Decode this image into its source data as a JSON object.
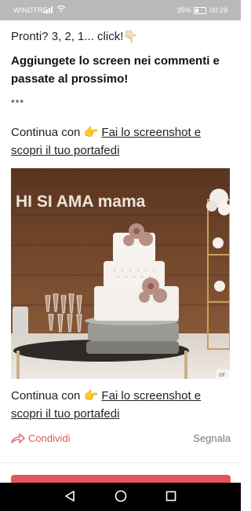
{
  "status_bar": {
    "carrier": "WINDTRE",
    "battery": "35%",
    "time": "00:29"
  },
  "post": {
    "line1": "Pronti? 3, 2, 1... click!👇🏻",
    "line2": "Aggiungete lo screen nei commenti e passate al prossimo!",
    "separator": "***",
    "continue_prefix": "Continua con 👉",
    "continue_link": "Fai lo screenshot e scopri il tuo portafedi",
    "image_sign": "HI SI AMA mama",
    "image_badge": "GF"
  },
  "actions": {
    "share_label": "Condividi",
    "report_label": "Segnala"
  },
  "icons": {
    "share": "share-arrow-icon",
    "back": "back-triangle-icon",
    "home": "home-circle-icon",
    "recents": "recents-square-icon",
    "signal": "signal-icon",
    "wifi": "wifi-icon",
    "battery": "battery-icon"
  },
  "colors": {
    "accent": "#e6555c",
    "status_bar_bg": "#b9b9b9",
    "nav_bar_bg": "#000000"
  }
}
